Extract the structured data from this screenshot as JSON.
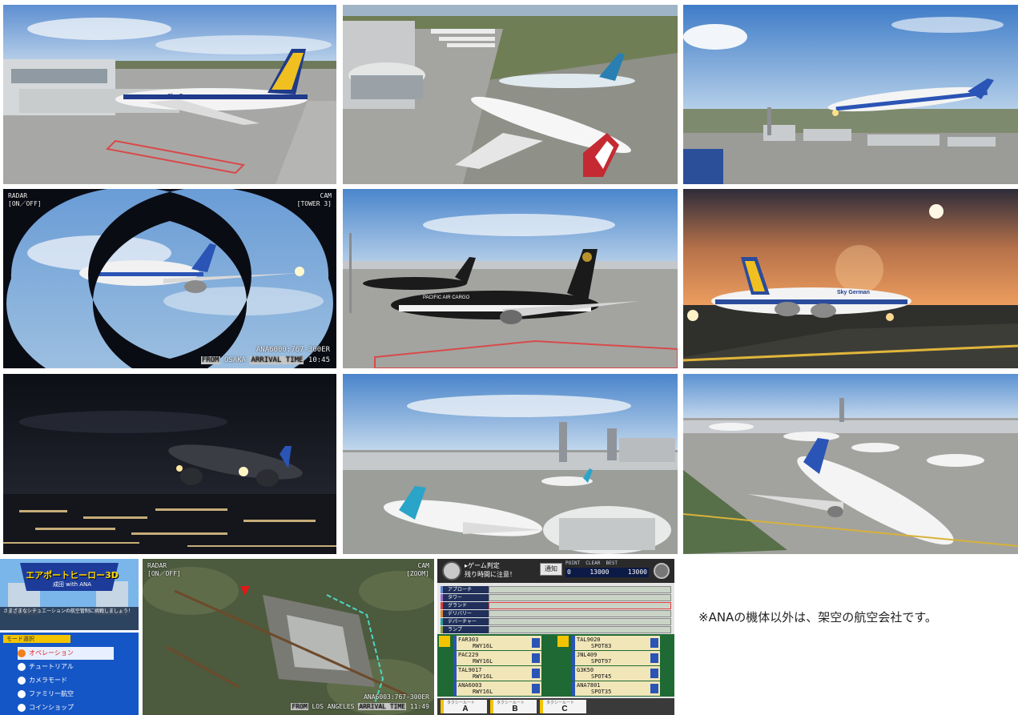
{
  "gallery": {
    "note": "※ANAの機体以外は、架空の航空会社です。",
    "shots": [
      {
        "id": "s1",
        "airline_livery": "Sky German"
      },
      {
        "id": "s2",
        "airline_livery": ""
      },
      {
        "id": "s3",
        "airline_livery": "ANA"
      },
      {
        "id": "s4",
        "radar_label": "RADAR",
        "radar_state": "[ON／OFF]",
        "cam_label": "CAM",
        "cam_state": "[TOWER 3]",
        "flight_code": "ANA6000:767-300ER",
        "from_label": "FROM",
        "from_city": "OSAKA",
        "arrival_label": "ARRIVAL TIME",
        "arrival_time": "10:45"
      },
      {
        "id": "s5",
        "airline_livery": "PACIFIC AIR CARGO"
      },
      {
        "id": "s6",
        "airline_livery": "Sky German"
      },
      {
        "id": "s7",
        "airline_livery": "ANA"
      },
      {
        "id": "s8",
        "airline_livery": ""
      },
      {
        "id": "s9",
        "airline_livery": "ANA"
      },
      {
        "id": "s10",
        "game_title": "エアポートヒーロー3D",
        "subtitle": "成田 with ANA",
        "hint": "さまざまなシチュエーションの航空管制に挑戦しましょう！",
        "menu_header": "モード選択",
        "menu_items": [
          "オペレーション",
          "チュートリアル",
          "カメラモード",
          "ファミリー航空",
          "コインショップ"
        ]
      },
      {
        "id": "s11",
        "radar_label": "RADAR",
        "radar_state": "[ON／OFF]",
        "cam_label": "CAM",
        "cam_state": "[ZOOM]",
        "flight_code": "ANA6003:767-300ER",
        "from_label": "FROM",
        "from_city": "LOS ANGELES",
        "arrival_label": "ARRIVAL TIME",
        "arrival_time": "11:49"
      },
      {
        "id": "s12",
        "judge_title": "ゲーム判定",
        "judge_warning": "残り時間に注意！",
        "notify_button": "通知",
        "point_label": "POINT",
        "clear_label": "CLEAR",
        "best_label": "BEST",
        "point_value": "0",
        "clear_value": "13000",
        "best_value": "13000",
        "lanes": [
          "アプローチ",
          "タワー",
          "グランド",
          "デリバリー",
          "デパーチャー",
          "ランプ"
        ],
        "left_flights": [
          {
            "code": "FAR303",
            "rwy": "RWY16L"
          },
          {
            "code": "PAC229",
            "rwy": "RWY16L"
          },
          {
            "code": "TAL9017",
            "rwy": "RWY16L"
          },
          {
            "code": "ANA6003",
            "rwy": "RWY16L"
          }
        ],
        "right_flights": [
          {
            "code": "TAL9020",
            "spot": "SPOT83"
          },
          {
            "code": "JNL409",
            "spot": "SPOT97"
          },
          {
            "code": "G3K50",
            "spot": "SPOT45"
          },
          {
            "code": "ANA7801",
            "spot": "SPOT35"
          }
        ],
        "route_label": "タクシールート",
        "routes": [
          "A",
          "B",
          "C"
        ]
      }
    ]
  }
}
